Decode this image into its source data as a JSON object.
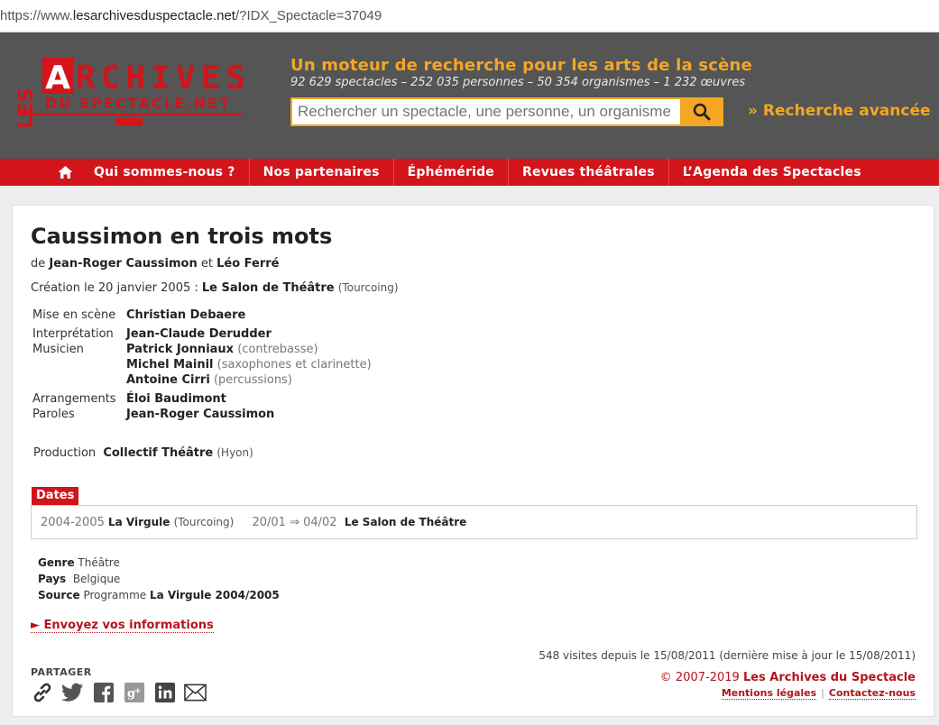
{
  "browser": {
    "url_prefix": "https://www.",
    "url_domain": "lesarchivesduspectacle.net",
    "url_rest": "/?IDX_Spectacle=37049"
  },
  "header": {
    "logo_les": "LES",
    "logo_archives": "ARCHIVES",
    "logo_sub": "DU SPECTACLE.NET",
    "tagline": "Un moteur de recherche pour les arts de la scène",
    "stats": "92 629 spectacles – 252 035 personnes – 50 354 organismes – 1 232 œuvres",
    "search_placeholder": "Rechercher un spectacle, une personne, un organisme",
    "advanced_search": "» Recherche avancée",
    "accent": "#f5a623"
  },
  "nav": {
    "items": [
      "Qui sommes-nous ?",
      "Nos partenaires",
      "Éphéméride",
      "Revues théâtrales",
      "L’Agenda des Spectacles"
    ],
    "color": "#d2141b"
  },
  "show": {
    "title": "Caussimon en trois mots",
    "by_prefix": "de",
    "author1": "Jean-Roger Caussimon",
    "and": "et",
    "author2": "Léo Ferré",
    "creation_prefix": "Création le 20 janvier 2005 :",
    "creation_venue": "Le Salon de Théâtre",
    "creation_city": "(Tourcoing)",
    "crew": {
      "mes_role": "Mise en scène",
      "mes_name": "Christian Debaere",
      "interp_role": "Interprétation",
      "interp_name": "Jean-Claude Derudder",
      "mus_role": "Musicien",
      "mus1_name": "Patrick Jonniaux",
      "mus1_inst": "(contrebasse)",
      "mus2_name": "Michel Mainil",
      "mus2_inst": "(saxophones et clarinette)",
      "mus3_name": "Antoine Cirri",
      "mus3_inst": "(percussions)",
      "arr_role": "Arrangements",
      "arr_name": "Éloi Baudimont",
      "par_role": "Paroles",
      "par_name": "Jean-Roger Caussimon"
    },
    "production_label": "Production",
    "production_name": "Collectif Théâtre",
    "production_city": "(Hyon)",
    "dates_label": "Dates",
    "dates": {
      "season": "2004-2005",
      "venue": "La Virgule",
      "city": "(Tourcoing)",
      "range": "20/01 ⇒ 04/02",
      "hall": "Le Salon de Théâtre"
    },
    "genre_label": "Genre",
    "genre": "Théâtre",
    "pays_label": "Pays",
    "pays": "Belgique",
    "source_label": "Source",
    "source_type": "Programme",
    "source_name": "La Virgule 2004/2005",
    "send_info": "► Envoyez vos informations"
  },
  "footer": {
    "visits": "548 visites depuis le 15/08/2011 (dernière mise à jour le 15/08/2011)",
    "share_label": "PARTAGER",
    "copyright_prefix": "© 2007-2019",
    "copyright_brand": "Les Archives du Spectacle",
    "legal": "Mentions légales",
    "contact": "Contactez-nous"
  }
}
